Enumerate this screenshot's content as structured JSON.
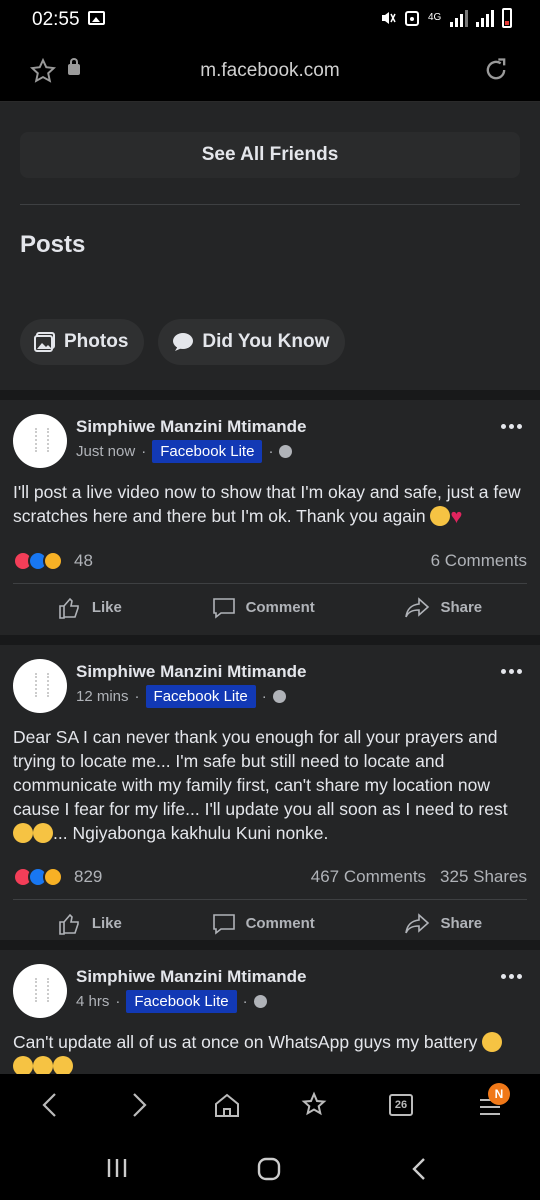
{
  "status_bar": {
    "time": "02:55",
    "network": "4G"
  },
  "browser": {
    "url": "m.facebook.com",
    "tab_count": "26",
    "menu_badge": "N"
  },
  "friends": {
    "see_all_label": "See All Friends"
  },
  "posts_section": {
    "title": "Posts",
    "chips": [
      {
        "label": "Photos",
        "icon": "photos-icon"
      },
      {
        "label": "Did You Know",
        "icon": "speech-bubble-icon"
      }
    ]
  },
  "posts": [
    {
      "author": "Simphiwe Manzini Mtimande",
      "time": "Just now",
      "badge": "Facebook Lite",
      "text": "I'll post a live video now to show that I'm okay and safe, just a few scratches here and there but I'm ok. Thank you again",
      "reactions": "48",
      "comments": "6 Comments",
      "shares": ""
    },
    {
      "author": "Simphiwe Manzini Mtimande",
      "time": "12 mins",
      "badge": "Facebook Lite",
      "text": "Dear SA I can never thank you enough for all your prayers and trying to locate me... I'm safe but still need to locate and communicate with my family first, can't share my location now cause I fear for my life... I'll update you all soon as I need to rest",
      "text_tail": "... Ngiyabonga kakhulu Kuni nonke.",
      "reactions": "829",
      "comments": "467 Comments",
      "shares": "325 Shares"
    },
    {
      "author": "Simphiwe Manzini Mtimande",
      "time": "4 hrs",
      "badge": "Facebook Lite",
      "text": "Can't update all of us at once on WhatsApp guys my battery"
    }
  ],
  "post_actions": {
    "like": "Like",
    "comment": "Comment",
    "share": "Share"
  }
}
